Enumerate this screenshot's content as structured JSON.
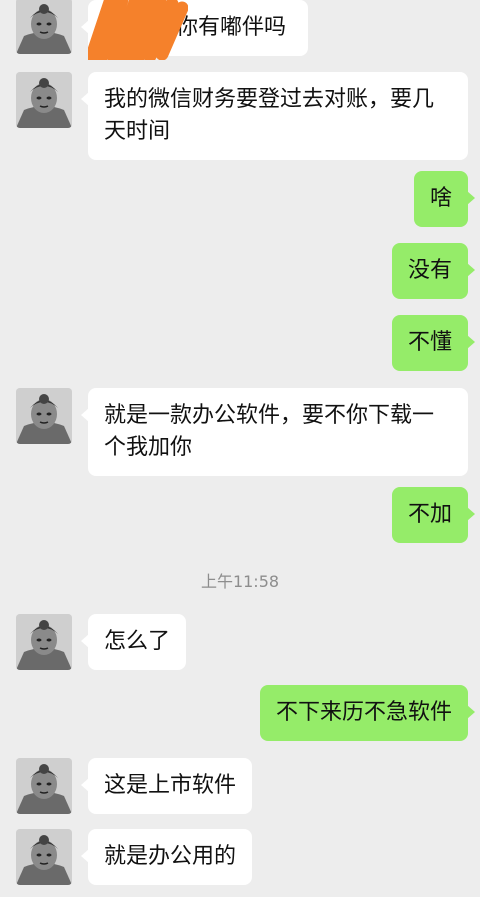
{
  "chat": {
    "messages": [
      {
        "side": "left",
        "text": "你有嘟伴吗"
      },
      {
        "side": "left",
        "text": "我的微信财务要登过去对账，要几天时间"
      },
      {
        "side": "right",
        "text": "啥"
      },
      {
        "side": "right",
        "text": "没有"
      },
      {
        "side": "right",
        "text": "不懂"
      },
      {
        "side": "left",
        "text": "就是一款办公软件，要不你下载一个我加你"
      },
      {
        "side": "right",
        "text": "不加"
      },
      {
        "side": "time",
        "text": "上午11:58"
      },
      {
        "side": "left",
        "text": "怎么了"
      },
      {
        "side": "right",
        "text": "不下来历不急软件"
      },
      {
        "side": "left",
        "text": "这是上市软件"
      },
      {
        "side": "left",
        "text": "就是办公用的"
      }
    ]
  },
  "colors": {
    "background": "#ededed",
    "outgoing_bubble": "#95ec69",
    "incoming_bubble": "#ffffff",
    "redaction_scribble": "#f5812b"
  },
  "icons": {
    "avatar": "contact-avatar-portrait",
    "redaction": "orange-redaction-scribble"
  }
}
